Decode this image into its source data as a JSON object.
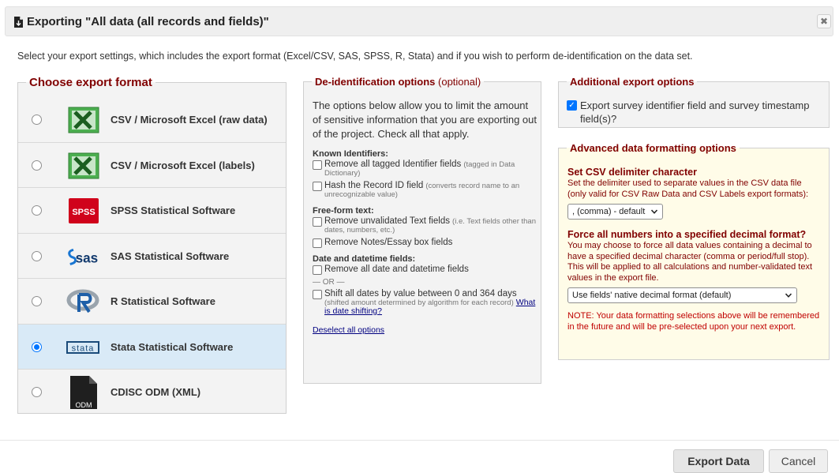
{
  "dialog": {
    "title": "Exporting \"All data (all records and fields)\"",
    "close_label": "✖",
    "intro": "Select your export settings, which includes the export format (Excel/CSV, SAS, SPSS, R, Stata) and if you wish to perform de-identification on the data set."
  },
  "formats": {
    "legend": "Choose export format",
    "items": [
      {
        "label": "CSV / Microsoft Excel (raw data)",
        "icon": "excel-icon",
        "selected": false
      },
      {
        "label": "CSV / Microsoft Excel (labels)",
        "icon": "excel-icon",
        "selected": false
      },
      {
        "label": "SPSS Statistical Software",
        "icon": "spss-icon",
        "selected": false
      },
      {
        "label": "SAS Statistical Software",
        "icon": "sas-icon",
        "selected": false
      },
      {
        "label": "R Statistical Software",
        "icon": "r-icon",
        "selected": false
      },
      {
        "label": "Stata Statistical Software",
        "icon": "stata-icon",
        "selected": true
      },
      {
        "label": "CDISC ODM (XML)",
        "icon": "odm-file-icon",
        "selected": false
      }
    ],
    "icon_text": {
      "spss": "SPSS",
      "sas": "sas",
      "stata": "stata",
      "odm": "ODM"
    }
  },
  "deid": {
    "legend": "De-identification options",
    "legend_optional": "(optional)",
    "intro": "The options below allow you to limit the amount of sensitive information that you are exporting out of the project. Check all that apply.",
    "known_identifiers": {
      "title": "Known Identifiers:",
      "remove_tagged": "Remove all tagged Identifier fields",
      "remove_tagged_hint": "(tagged in Data Dictionary)",
      "hash_record": "Hash the Record ID field",
      "hash_record_hint": "(converts record name to an unrecognizable value)"
    },
    "free_form": {
      "title": "Free-form text:",
      "remove_unvalidated": "Remove unvalidated Text fields",
      "remove_unvalidated_hint": "(i.e. Text fields other than dates, numbers, etc.)",
      "remove_notes": "Remove Notes/Essay box fields"
    },
    "dates": {
      "title": "Date and datetime fields:",
      "remove_dates": "Remove all date and datetime fields",
      "or": "— OR —",
      "shift_dates": "Shift all dates by value between 0 and 364 days",
      "shift_dates_hint": "(shifted amount determined by algorithm for each record)",
      "date_shift_link": "What is date shifting?"
    },
    "deselect_link": "Deselect all options"
  },
  "additional": {
    "legend": "Additional export options",
    "export_survey_fields": "Export survey identifier field and survey timestamp field(s)?",
    "checked_mark": "✓"
  },
  "advanced": {
    "legend": "Advanced data formatting options",
    "delimiter_heading": "Set CSV delimiter character",
    "delimiter_desc": "Set the delimiter used to separate values in the CSV data file (only valid for CSV Raw Data and CSV Labels export formats):",
    "delimiter_value": ", (comma) - default",
    "decimal_heading": "Force all numbers into a specified decimal format?",
    "decimal_desc": "You may choose to force all data values containing a decimal to have a specified decimal character (comma or period/full stop). This will be applied to all calculations and number-validated text values in the export file.",
    "decimal_value": "Use fields' native decimal format (default)",
    "note": "NOTE: Your data formatting selections above will be remembered in the future and will be pre-selected upon your next export."
  },
  "footer": {
    "export_label": "Export Data",
    "cancel_label": "Cancel"
  },
  "colors": {
    "maroon": "#800000",
    "selected_row": "#d9eaf7",
    "advanced_bg": "#fffce8",
    "note_red": "#c00000",
    "radio_blue": "#0075ff"
  }
}
